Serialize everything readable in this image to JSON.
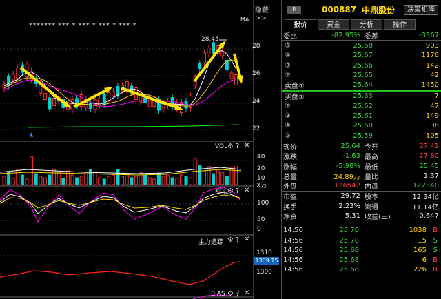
{
  "toolbar": {
    "hide_label": "隐藏>>"
  },
  "chart": {
    "ma_label": "MA",
    "stars": "******* ***  *   ***  *  ***  *  ***  *",
    "peak_price": "28.45",
    "price_axis": [
      "28",
      "26",
      "24",
      "22"
    ],
    "vol_title": "VOL",
    "vol_axis": [
      "40",
      "20",
      "10"
    ],
    "vol_unit": "X万",
    "kdj_title": "KDJ",
    "kdj_axis": [
      "100",
      "50",
      "0"
    ],
    "main_title": "主力追踪",
    "main_axis": [
      "1310",
      "1300"
    ],
    "main_current": "1309.15",
    "bias_title": "BIAS",
    "colors": {
      "up": "#ff3030",
      "down": "#00d0d0",
      "arrow": "#ffe600",
      "ma_white": "#ffffff",
      "ma_yellow": "#ffd700",
      "ma_magenta": "#ff00ff",
      "ma_green": "#00ff00"
    }
  },
  "header": {
    "badge": "R",
    "code": "000887",
    "name": "中鼎股份",
    "decision_button": "决策矩阵"
  },
  "tabs": [
    "报价",
    "资金",
    "分析",
    "操作"
  ],
  "weibi": {
    "label1": "委比",
    "value1": "-82.95%",
    "label2": "委差",
    "value2": "-3367"
  },
  "sell_orders": [
    {
      "label": "⑤",
      "price": "25.68",
      "volume": "903"
    },
    {
      "label": "④",
      "price": "25.67",
      "volume": "1176"
    },
    {
      "label": "③",
      "price": "25.66",
      "volume": "142"
    },
    {
      "label": "②",
      "price": "25.65",
      "volume": "42"
    },
    {
      "label": "卖盘①",
      "price": "25.64",
      "volume": "1450"
    }
  ],
  "buy_orders": [
    {
      "label": "买盘①",
      "price": "25.63",
      "volume": "7"
    },
    {
      "label": "②",
      "price": "25.62",
      "volume": "47"
    },
    {
      "label": "③",
      "price": "25.61",
      "volume": "149"
    },
    {
      "label": "④",
      "price": "25.60",
      "volume": "38"
    },
    {
      "label": "⑤",
      "price": "25.59",
      "volume": "105"
    }
  ],
  "quote": [
    {
      "l1": "现价",
      "v1": "25.64",
      "l2": "今开",
      "v2": "27.41"
    },
    {
      "l1": "涨跌",
      "v1": "-1.63",
      "l2": "最高",
      "v2": "27.80"
    },
    {
      "l1": "涨幅",
      "v1": "-5.98%",
      "l2": "最低",
      "v2": "25.45"
    },
    {
      "l1": "总量",
      "v1": "24.89万",
      "l2": "量比",
      "v2": "1.37"
    },
    {
      "l1": "外盘",
      "v1": "126542",
      "l2": "内盘",
      "v2": "122340"
    }
  ],
  "fundamentals": [
    {
      "l1": "市盈",
      "v1": "29.72",
      "l2": "股本",
      "v2": "12.34亿"
    },
    {
      "l1": "换手",
      "v1": "2.23%",
      "l2": "流通",
      "v2": "11.14亿"
    },
    {
      "l1": "净资",
      "v1": "5.31",
      "l2": "收益(三)",
      "v2": "0.647"
    }
  ],
  "ticks": [
    {
      "time": "14:56",
      "price": "25.70",
      "volume": "1038",
      "dir": "B"
    },
    {
      "time": "14:56",
      "price": "25.70",
      "volume": "15",
      "dir": "S"
    },
    {
      "time": "14:56",
      "price": "25.68",
      "volume": "165",
      "dir": "S"
    },
    {
      "time": "14:56",
      "price": "25.68",
      "volume": "6",
      "dir": "B"
    },
    {
      "time": "14:56",
      "price": "25.68",
      "volume": "226",
      "dir": "B"
    }
  ]
}
